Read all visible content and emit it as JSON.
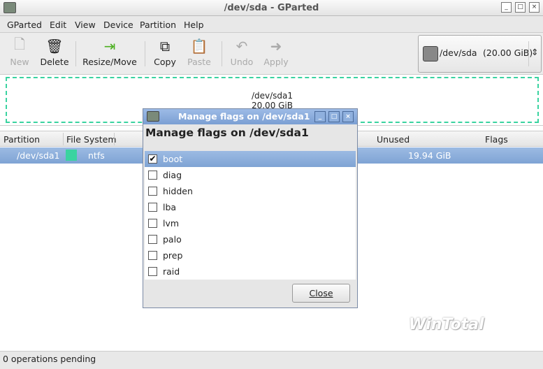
{
  "window": {
    "title": "/dev/sda - GParted"
  },
  "menu": [
    "GParted",
    "Edit",
    "View",
    "Device",
    "Partition",
    "Help"
  ],
  "toolbar": {
    "new": "New",
    "delete": "Delete",
    "resize": "Resize/Move",
    "copy": "Copy",
    "paste": "Paste",
    "undo": "Undo",
    "apply": "Apply"
  },
  "device": {
    "name": "/dev/sda",
    "size": "(20.00 GiB)"
  },
  "map": {
    "name": "/dev/sda1",
    "size": "20.00 GiB"
  },
  "columns": {
    "partition": "Partition",
    "filesystem": "File System",
    "unused": "Unused",
    "flags": "Flags"
  },
  "row": {
    "partition": "/dev/sda1",
    "filesystem": "ntfs",
    "unused": "19.94 GiB",
    "fs_color": "#3ad3a0"
  },
  "status": "0 operations pending",
  "dialog": {
    "title": "Manage flags on /dev/sda1",
    "heading": "Manage flags on /dev/sda1",
    "close": "Close",
    "flags": [
      {
        "name": "boot",
        "checked": true
      },
      {
        "name": "diag",
        "checked": false
      },
      {
        "name": "hidden",
        "checked": false
      },
      {
        "name": "lba",
        "checked": false
      },
      {
        "name": "lvm",
        "checked": false
      },
      {
        "name": "palo",
        "checked": false
      },
      {
        "name": "prep",
        "checked": false
      },
      {
        "name": "raid",
        "checked": false
      }
    ]
  },
  "watermark": "WinTotal"
}
